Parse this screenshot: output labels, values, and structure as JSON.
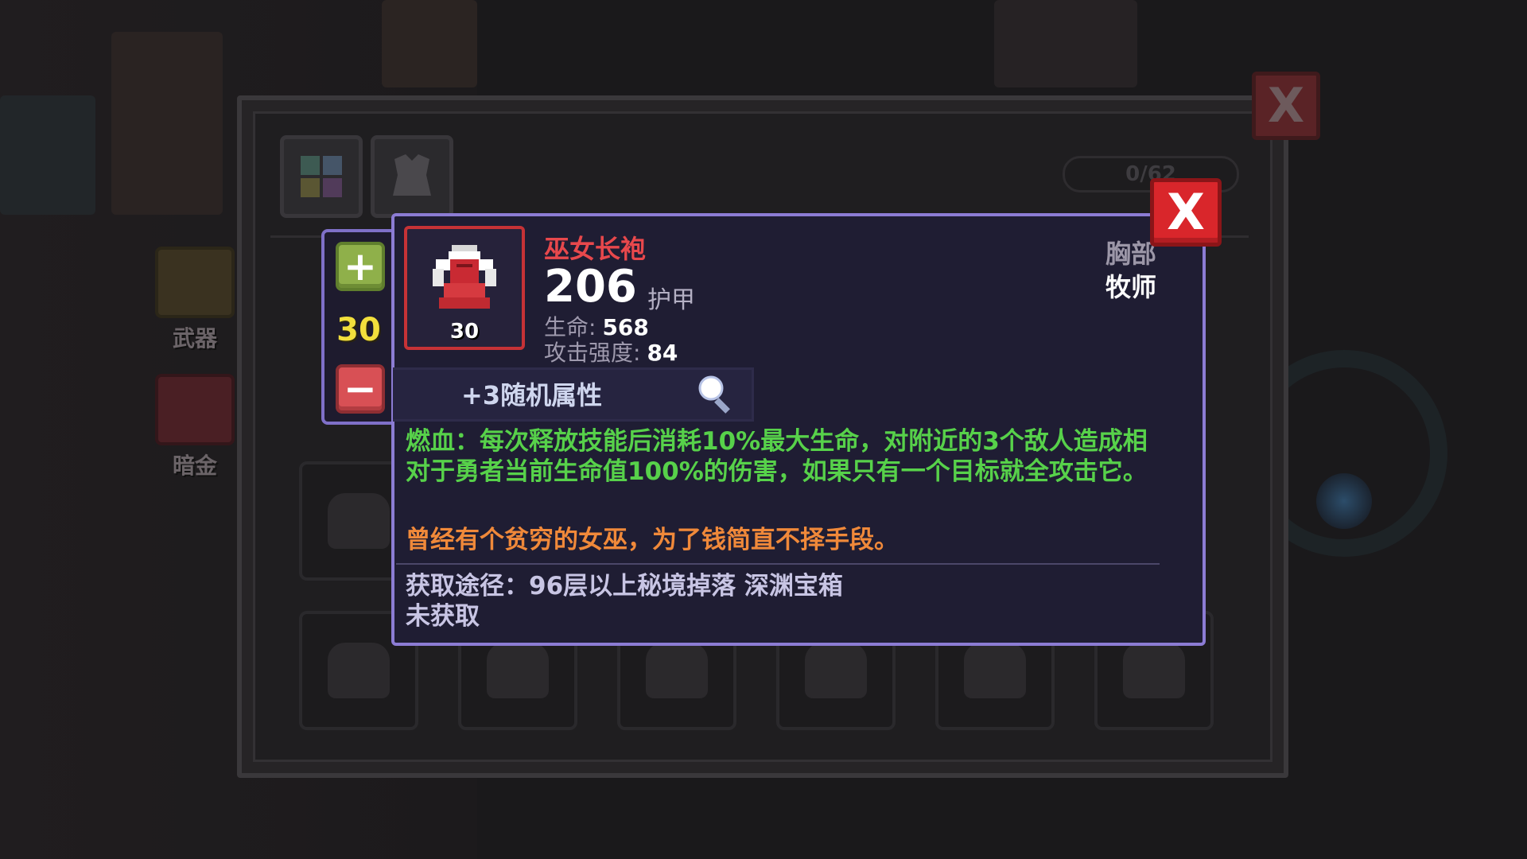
{
  "background": {
    "categories": [
      {
        "label": "武器"
      },
      {
        "label": "暗金"
      }
    ],
    "slot_counter": "0/62"
  },
  "stepper": {
    "plus_label": "+",
    "level": "30",
    "minus_label": "−"
  },
  "item": {
    "name": "巫女长袍",
    "level": "30",
    "armor_value": "206",
    "armor_label": "护甲",
    "stats": [
      {
        "label": "生命:",
        "value": "568"
      },
      {
        "label": "攻击强度:",
        "value": "84"
      }
    ],
    "slot_type": "胸部",
    "class": "牧师",
    "random_attributes": "+3随机属性",
    "effect_text": "燃血：每次释放技能后消耗10%最大生命，对附近的3个敌人造成相对于勇者当前生命值100%的伤害，如果只有一个目标就全攻击它。",
    "flavor_text": "曾经有个贫穷的女巫，为了钱简直不择手段。",
    "source": "获取途径：96层以上秘境掉落 深渊宝箱",
    "status": "未获取",
    "icon": "robe-icon"
  },
  "close_label": "X",
  "colors": {
    "item_name": "#e8484c",
    "effect": "#57d14a",
    "flavor": "#f0893a",
    "level": "#f2df3c",
    "popup_border": "#8c7cd4",
    "close_button": "#d9262b"
  }
}
